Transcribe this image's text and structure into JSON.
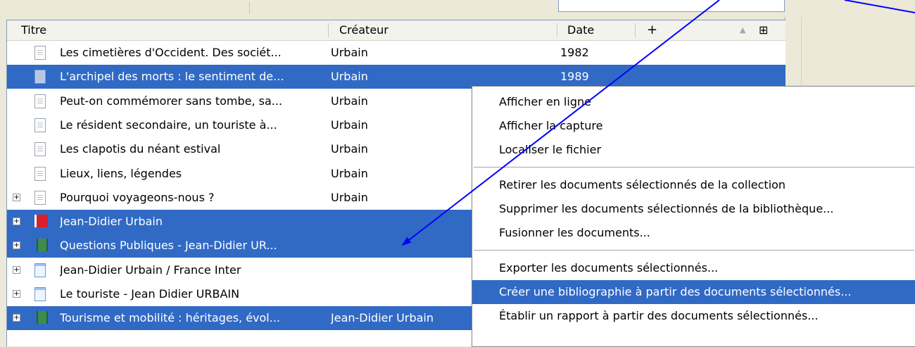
{
  "columns": {
    "title": "Titre",
    "creator": "Créateur",
    "date": "Date",
    "add": "+",
    "sort": "▲",
    "picker": "⊞"
  },
  "rows": [
    {
      "title": "Les cimetières d'Occident. Des sociét...",
      "creator": "Urbain",
      "date": "1982",
      "icon": "document-icon",
      "selected": false,
      "expander": false
    },
    {
      "title": "L'archipel des morts : le sentiment de...",
      "creator": "Urbain",
      "date": "1989",
      "icon": "document-icon",
      "selected": true,
      "expander": false
    },
    {
      "title": "Peut-on commémorer sans tombe, sa...",
      "creator": "Urbain",
      "date": "",
      "icon": "document-icon",
      "selected": false,
      "expander": false
    },
    {
      "title": "Le résident secondaire, un touriste à...",
      "creator": "Urbain",
      "date": "",
      "icon": "document-icon",
      "selected": false,
      "expander": false
    },
    {
      "title": "Les clapotis du néant estival",
      "creator": "Urbain",
      "date": "",
      "icon": "document-icon",
      "selected": false,
      "expander": false
    },
    {
      "title": "Lieux, liens, légendes",
      "creator": "Urbain",
      "date": "",
      "icon": "document-icon",
      "selected": false,
      "expander": false
    },
    {
      "title": "Pourquoi voyageons-nous ?",
      "creator": "Urbain",
      "date": "",
      "icon": "document-icon",
      "selected": false,
      "expander": true
    },
    {
      "title": "Jean-Didier Urbain",
      "creator": "",
      "date": "",
      "icon": "book-icon",
      "selected": true,
      "expander": true
    },
    {
      "title": "Questions Publiques - Jean-Didier UR...",
      "creator": "",
      "date": "",
      "icon": "film-icon",
      "selected": true,
      "expander": true
    },
    {
      "title": "Jean-Didier Urbain / France Inter",
      "creator": "",
      "date": "",
      "icon": "webpage-icon",
      "selected": false,
      "expander": true
    },
    {
      "title": "Le touriste - Jean Didier URBAIN",
      "creator": "",
      "date": "",
      "icon": "webpage-icon",
      "selected": false,
      "expander": true
    },
    {
      "title": "Tourisme et mobilité : héritages, évol...",
      "creator": "Jean-Didier Urbain",
      "date": "",
      "icon": "film-icon",
      "selected": true,
      "expander": true
    }
  ],
  "context_menu": {
    "groups": [
      [
        "Afficher en ligne",
        "Afficher la capture",
        "Localiser le fichier"
      ],
      [
        "Retirer les documents sélectionnés de la collection",
        "Supprimer les documents sélectionnés de la bibliothèque...",
        "Fusionner les documents..."
      ],
      [
        "Exporter les documents sélectionnés...",
        "Créer une bibliographie à partir des documents sélectionnés...",
        "Établir un rapport à partir des documents sélectionnés..."
      ]
    ],
    "highlighted": "Créer une bibliographie à partir des documents sélectionnés..."
  },
  "colors": {
    "selection": "#316ac5",
    "annotation_arrow": "#0000ff"
  }
}
